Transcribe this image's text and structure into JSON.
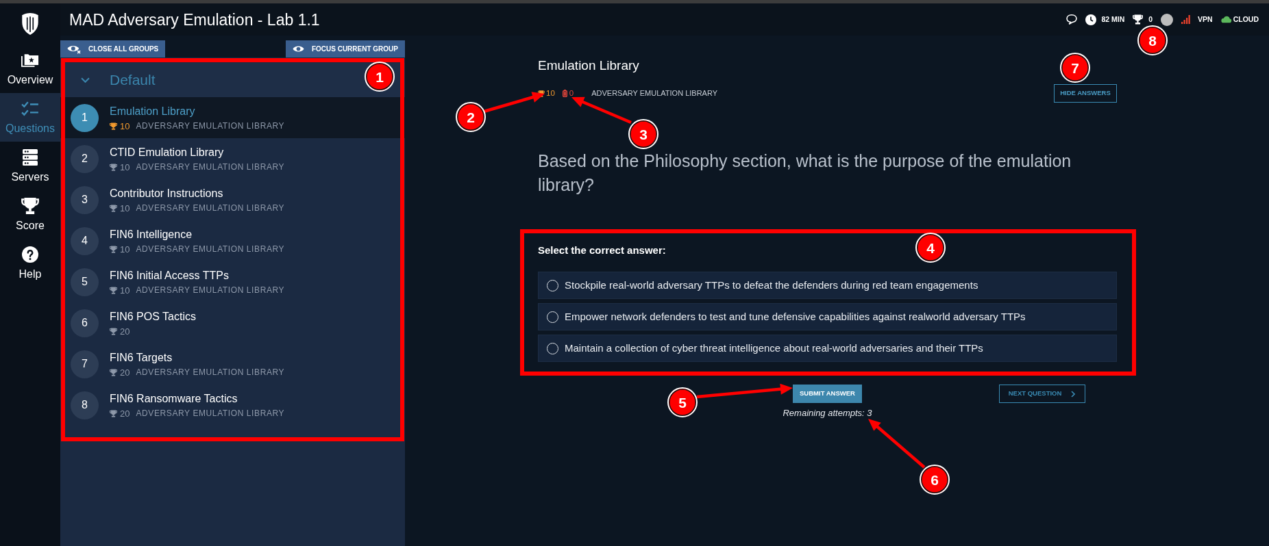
{
  "window": {
    "title": "MAD Adversary Emulation - Lab 1.1"
  },
  "nav": {
    "items": [
      {
        "label": "Overview",
        "kind": "overview",
        "selected": false
      },
      {
        "label": "Questions",
        "kind": "questions",
        "selected": true
      },
      {
        "label": "Servers",
        "kind": "servers",
        "selected": false
      },
      {
        "label": "Score",
        "kind": "score",
        "selected": false
      },
      {
        "label": "Help",
        "kind": "help",
        "selected": false
      }
    ]
  },
  "header_status": {
    "time": "82 MIN",
    "score": "0",
    "indicators": [
      {
        "label": "VPN",
        "kind": "signal",
        "color": "#e8412c"
      },
      {
        "label": "CLOUD",
        "kind": "cloud",
        "color": "#5cb85c"
      }
    ]
  },
  "sidebar": {
    "buttons": [
      {
        "label": "CLOSE ALL GROUPS",
        "kind": "close"
      },
      {
        "label": "FOCUS CURRENT GROUP",
        "kind": "focus"
      }
    ],
    "groups": [
      {
        "title": "Default",
        "expanded": true,
        "items": [
          {
            "number": "1",
            "title": "Emulation Library",
            "points": "10",
            "category": "ADVERSARY EMULATION LIBRARY",
            "selected": true
          },
          {
            "number": "2",
            "title": "CTID Emulation Library",
            "points": "10",
            "category": "ADVERSARY EMULATION LIBRARY",
            "selected": false
          },
          {
            "number": "3",
            "title": "Contributor Instructions",
            "points": "10",
            "category": "ADVERSARY EMULATION LIBRARY",
            "selected": false
          },
          {
            "number": "4",
            "title": "FIN6 Intelligence",
            "points": "10",
            "category": "ADVERSARY EMULATION LIBRARY",
            "selected": false
          },
          {
            "number": "5",
            "title": "FIN6 Initial Access TTPs",
            "points": "10",
            "category": "ADVERSARY EMULATION LIBRARY",
            "selected": false
          },
          {
            "number": "6",
            "title": "FIN6 POS Tactics",
            "points": "20",
            "selected": false
          },
          {
            "number": "7",
            "title": "FIN6 Targets",
            "points": "20",
            "category": "ADVERSARY EMULATION LIBRARY",
            "selected": false
          },
          {
            "number": "8",
            "title": "FIN6 Ransomware Tactics",
            "points": "20",
            "category": "ADVERSARY EMULATION LIBRARY",
            "selected": false
          }
        ]
      }
    ]
  },
  "question": {
    "title": "Emulation Library",
    "points": "10",
    "count": "0",
    "category": "ADVERSARY EMULATION LIBRARY",
    "hide_answers_button": "HIDE ANSWERS",
    "text": "Based on the Philosophy section, what is the purpose of the emulation library?",
    "prompt": "Select the correct answer:",
    "options": [
      {
        "text": "Stockpile real-world adversary TTPs to defeat the defenders during red team engagements",
        "selected": false
      },
      {
        "text": "Empower network defenders to test and tune defensive capabilities against realworld adversary TTPs",
        "selected": false
      },
      {
        "text": "Maintain a collection of cyber threat intelligence about real-world adversaries and their TTPs",
        "selected": false
      }
    ],
    "submit_button": "SUBMIT ANSWER",
    "next_button": "NEXT QUESTION",
    "remaining": "Remaining attempts: 3"
  },
  "annotations": [
    {
      "label": "1",
      "kind": "frame"
    },
    {
      "label": "2",
      "kind": "arrow"
    },
    {
      "label": "3",
      "kind": "arrow"
    },
    {
      "label": "4",
      "kind": "frame"
    },
    {
      "label": "5",
      "kind": "arrow"
    },
    {
      "label": "6",
      "kind": "arrow"
    },
    {
      "label": "7",
      "kind": "plain"
    },
    {
      "label": "8",
      "kind": "plain"
    }
  ]
}
